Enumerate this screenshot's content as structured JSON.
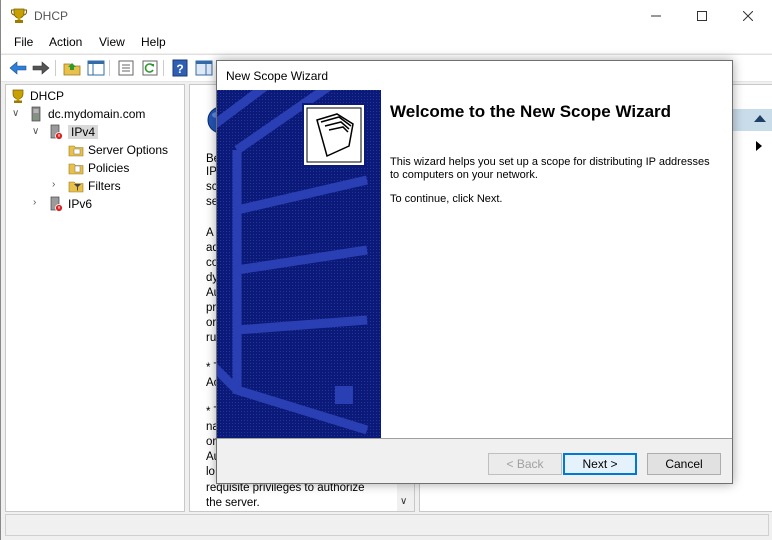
{
  "window": {
    "title": "DHCP"
  },
  "menu": [
    "File",
    "Action",
    "View",
    "Help"
  ],
  "tree": {
    "root": "DHCP",
    "server": "dc.mydomain.com",
    "ipv4": "IPv4",
    "server_options": "Server Options",
    "policies": "Policies",
    "filters": "Filters",
    "ipv6": "IPv6"
  },
  "middle_fragments": [
    "Be",
    "IP",
    "sc",
    "se",
    "",
    "A",
    "ad",
    "co",
    "dy",
    "Au",
    "pr",
    "or",
    "ru",
    "",
    "* T",
    "Ac",
    "",
    "* T",
    "na",
    "or",
    "Au",
    "lo"
  ],
  "middle_visible": {
    "line1": "requisite privileges to authorize",
    "line2": "the server."
  },
  "wizard": {
    "title": "New Scope Wizard",
    "heading": "Welcome to the New Scope Wizard",
    "description": "This wizard helps you set up a scope for distributing IP addresses to computers on your network.",
    "continue": "To continue, click Next.",
    "back_label": "< Back",
    "next_label": "Next >",
    "cancel_label": "Cancel"
  },
  "colors": {
    "banner": "#0b1a78",
    "selection": "#d9d9d9",
    "actions_header": "#c9dcea",
    "accent": "#0078d7"
  }
}
